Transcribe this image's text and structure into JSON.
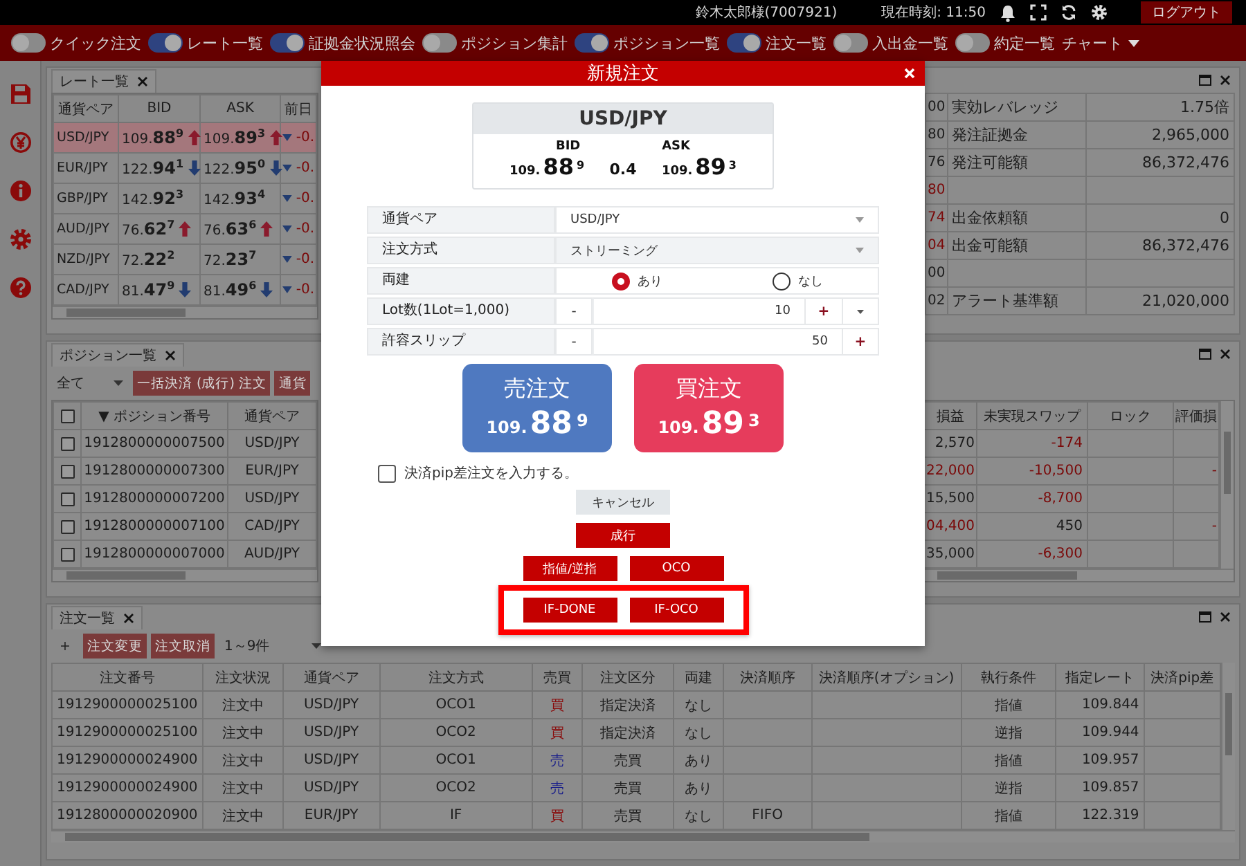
{
  "top_bar": {
    "user": "鈴木太郎様(7007921)",
    "clock": "現在時刻: 11:50",
    "logout": "ログアウト"
  },
  "toolbar": {
    "toggles": [
      {
        "label": "クイック注文",
        "on": false
      },
      {
        "label": "レート一覧",
        "on": true
      },
      {
        "label": "証拠金状況照会",
        "on": true
      },
      {
        "label": "ポジション集計",
        "on": false
      },
      {
        "label": "ポジション一覧",
        "on": true
      },
      {
        "label": "注文一覧",
        "on": true
      },
      {
        "label": "入出金一覧",
        "on": false
      },
      {
        "label": "約定一覧",
        "on": false
      }
    ],
    "chart_menu": "チャート"
  },
  "rate_panel": {
    "tab": "レート一覧",
    "columns": [
      "通貨ペア",
      "BID",
      "ASK",
      "前日"
    ],
    "rows": [
      {
        "pair": "USD/JPY",
        "selected": true,
        "bid": {
          "big_figure": "109.",
          "pips": "88",
          "fraction": "9",
          "kind": "up"
        },
        "ask": {
          "big_figure": "109.",
          "pips": "89",
          "fraction": "3",
          "kind": "up"
        },
        "change": "-0."
      },
      {
        "pair": "EUR/JPY",
        "selected": false,
        "bid": {
          "big_figure": "122.",
          "pips": "94",
          "fraction": "1",
          "kind": "down"
        },
        "ask": {
          "big_figure": "122.",
          "pips": "95",
          "fraction": "0",
          "kind": "down"
        },
        "change": "-0."
      },
      {
        "pair": "GBP/JPY",
        "selected": false,
        "bid": {
          "big_figure": "142.",
          "pips": "92",
          "fraction": "3",
          "kind": "flat"
        },
        "ask": {
          "big_figure": "142.",
          "pips": "93",
          "fraction": "4",
          "kind": "flat"
        },
        "change": "-0."
      },
      {
        "pair": "AUD/JPY",
        "selected": false,
        "bid": {
          "big_figure": "76.",
          "pips": "62",
          "fraction": "7",
          "kind": "up"
        },
        "ask": {
          "big_figure": "76.",
          "pips": "63",
          "fraction": "6",
          "kind": "up"
        },
        "change": "-0."
      },
      {
        "pair": "NZD/JPY",
        "selected": false,
        "bid": {
          "big_figure": "72.",
          "pips": "22",
          "fraction": "2",
          "kind": "flat"
        },
        "ask": {
          "big_figure": "72.",
          "pips": "23",
          "fraction": "7",
          "kind": "flat"
        },
        "change": "-0."
      },
      {
        "pair": "CAD/JPY",
        "selected": false,
        "bid": {
          "big_figure": "81.",
          "pips": "47",
          "fraction": "9",
          "kind": "down"
        },
        "ask": {
          "big_figure": "81.",
          "pips": "49",
          "fraction": "6",
          "kind": "down"
        },
        "change": "-0."
      }
    ]
  },
  "account_panel": {
    "rows": [
      {
        "column_1": "00",
        "negative": false,
        "label": "実効レバレッジ",
        "value": "1.75倍"
      },
      {
        "column_1": "80",
        "negative": false,
        "label": "発注証拠金",
        "value": "2,965,000"
      },
      {
        "column_1": "76",
        "negative": false,
        "label": "発注可能額",
        "value": "86,372,476"
      },
      {
        "column_1": "80",
        "negative": true
      },
      {
        "column_1": "74",
        "negative": true,
        "label": "出金依頼額",
        "value": "0"
      },
      {
        "column_1": "04",
        "negative": true,
        "label": "出金可能額",
        "value": "86,372,476"
      },
      {
        "column_1": "00",
        "negative": false
      },
      {
        "column_1": "02",
        "negative": false,
        "label": "アラート基準額",
        "value": "21,020,000"
      }
    ]
  },
  "position_panel": {
    "tab": "ポジション一覧",
    "filter": "全て",
    "buttons": [
      "一括決済 (成行) 注文",
      "通貨"
    ],
    "select_all_checked": false,
    "left_columns": [
      "▼ ポジション番号",
      "通貨ペア"
    ],
    "right_columns": [
      "損益",
      "未実現スワップ",
      "ロック",
      "評価損"
    ],
    "rows": [
      {
        "checked": false,
        "position_no": "1912800000007500",
        "pair": "USD/JPY",
        "column_4": "2,570",
        "column_4_negative": false,
        "swap": "-174",
        "swap_negative": true
      },
      {
        "checked": false,
        "position_no": "1912800000007300",
        "pair": "EUR/JPY",
        "column_4": "22,000",
        "column_4_negative": true,
        "swap": "-10,500",
        "swap_negative": true,
        "column_7": "-"
      },
      {
        "checked": false,
        "position_no": "1912800000007200",
        "pair": "USD/JPY",
        "column_4": "15,500",
        "column_4_negative": false,
        "swap": "-8,700",
        "swap_negative": true
      },
      {
        "checked": false,
        "position_no": "1912800000007100",
        "pair": "CAD/JPY",
        "column_4": "04,400",
        "column_4_negative": true,
        "swap": "450",
        "swap_negative": false,
        "column_7": "-"
      },
      {
        "checked": false,
        "position_no": "1912800000007000",
        "pair": "AUD/JPY",
        "column_4": "35,000",
        "column_4_negative": false,
        "swap": "-6,300",
        "swap_negative": true
      }
    ]
  },
  "order_panel": {
    "tab": "注文一覧",
    "add": "+",
    "buttons": [
      "注文変更",
      "注文取消"
    ],
    "range": "1～9件",
    "columns": [
      "注文番号",
      "注文状況",
      "通貨ペア",
      "注文方式",
      "売買",
      "注文区分",
      "両建",
      "決済順序",
      "決済順序(オプション)",
      "執行条件",
      "指定レート",
      "決済pip差"
    ],
    "rows": [
      {
        "order_no": "1912900000025100",
        "status": "注文中",
        "pair": "USD/JPY",
        "method": "OCO1",
        "kind": "buy",
        "side_label": "買",
        "category": "指定決済",
        "hedge": "なし",
        "condition": "指値",
        "rate": "109.844"
      },
      {
        "order_no": "1912900000025100",
        "status": "注文中",
        "pair": "USD/JPY",
        "method": "OCO2",
        "kind": "buy",
        "side_label": "買",
        "category": "指定決済",
        "hedge": "なし",
        "condition": "逆指",
        "rate": "109.944"
      },
      {
        "order_no": "1912900000024900",
        "status": "注文中",
        "pair": "USD/JPY",
        "method": "OCO1",
        "kind": "sell",
        "side_label": "売",
        "category": "売買",
        "hedge": "あり",
        "condition": "指値",
        "rate": "109.957"
      },
      {
        "order_no": "1912900000024900",
        "status": "注文中",
        "pair": "USD/JPY",
        "method": "OCO2",
        "kind": "sell",
        "side_label": "売",
        "category": "売買",
        "hedge": "あり",
        "condition": "逆指",
        "rate": "109.857"
      },
      {
        "order_no": "1912800000020900",
        "status": "注文中",
        "pair": "EUR/JPY",
        "method": "IF",
        "kind": "buy",
        "side_label": "買",
        "category": "売買",
        "hedge": "なし",
        "settle_order": "FIFO",
        "condition": "指値",
        "rate": "122.319"
      }
    ]
  },
  "modal": {
    "title": "新規注文",
    "quote": {
      "pair": "USD/JPY",
      "bid_label": "BID",
      "ask_label": "ASK",
      "bid": {
        "big_figure": "109.",
        "pips": "88",
        "fraction": "9"
      },
      "spread": "0.4",
      "ask": {
        "big_figure": "109.",
        "pips": "89",
        "fraction": "3"
      }
    },
    "form": [
      {
        "kind": "select",
        "label": "通貨ペア",
        "value": "USD/JPY"
      },
      {
        "kind": "select",
        "label": "注文方式",
        "value": "ストリーミング"
      },
      {
        "kind": "radio",
        "label": "両建",
        "options": [
          {
            "label": "あり",
            "selected": true
          },
          {
            "label": "なし",
            "selected": false
          }
        ]
      },
      {
        "kind": "stepper",
        "label": "Lot数(1Lot=1,000)",
        "minus": "-",
        "value": "10",
        "plus": "+",
        "dropdown": true
      },
      {
        "kind": "stepper",
        "label": "許容スリップ",
        "minus": "-",
        "value": "50",
        "plus": "+",
        "dropdown": false
      }
    ],
    "sell": {
      "label": "売注文",
      "big_figure": "109.",
      "pips": "88",
      "fraction": "9"
    },
    "buy": {
      "label": "買注文",
      "big_figure": "109.",
      "pips": "89",
      "fraction": "3"
    },
    "pip_checkbox": {
      "label": "決済pip差注文を入力する。",
      "checked": false
    },
    "cancel": "キャンセル",
    "order_rows": [
      {
        "buttons": [
          "成行"
        ],
        "highlighted": false
      },
      {
        "buttons": [
          "指値/逆指",
          "OCO"
        ],
        "highlighted": false
      },
      {
        "buttons": [
          "IF-DONE",
          "IF-OCO"
        ],
        "highlighted": true
      }
    ]
  }
}
